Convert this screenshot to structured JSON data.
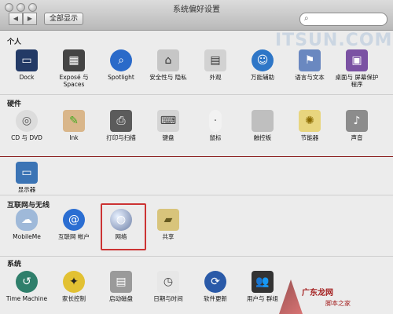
{
  "window": {
    "title": "系统偏好设置",
    "show_all": "全部显示",
    "search_placeholder": ""
  },
  "watermark": {
    "text": "ITSUN.COM"
  },
  "sections": [
    {
      "title": "个人",
      "items": [
        {
          "label": "Dock",
          "icon": "dock-icon",
          "color": "#233a66"
        },
        {
          "label": "Exposé 与 Spaces",
          "icon": "expose-spaces-icon",
          "color": "#444"
        },
        {
          "label": "Spotlight",
          "icon": "spotlight-icon",
          "color": "#2a6ac9"
        },
        {
          "label": "安全性与 隐私",
          "icon": "security-house-icon",
          "color": "#c6c6c6"
        },
        {
          "label": "外观",
          "icon": "appearance-icon",
          "color": "#d2d2d2"
        },
        {
          "label": "万能辅助",
          "icon": "accessibility-icon",
          "color": "#2e76c7"
        },
        {
          "label": "语言与文本",
          "icon": "language-flag-icon",
          "color": "#6a88c0"
        },
        {
          "label": "桌面与 屏幕保护程序",
          "icon": "desktop-screensaver-icon",
          "color": "#7b52a3"
        }
      ]
    },
    {
      "title": "硬件",
      "items": [
        {
          "label": "CD 与 DVD",
          "icon": "cd-dvd-icon",
          "color": "#dcdcdc"
        },
        {
          "label": "Ink",
          "icon": "ink-icon",
          "color": "#d9b68a"
        },
        {
          "label": "打印与扫描",
          "icon": "printer-icon",
          "color": "#5b5b5b"
        },
        {
          "label": "键盘",
          "icon": "keyboard-icon",
          "color": "#d5d5d5"
        },
        {
          "label": "鼠标",
          "icon": "mouse-icon",
          "color": "#f2f2f2"
        },
        {
          "label": "触控板",
          "icon": "trackpad-icon",
          "color": "#bfbfbf"
        },
        {
          "label": "节能器",
          "icon": "energy-bulb-icon",
          "color": "#e8d57e"
        },
        {
          "label": "声音",
          "icon": "speaker-icon",
          "color": "#8c8c8c"
        }
      ]
    },
    {
      "title": "",
      "items": [
        {
          "label": "显示器",
          "icon": "display-icon",
          "color": "#3b74b5"
        }
      ]
    },
    {
      "title": "互联网与无线",
      "items": [
        {
          "label": "MobileMe",
          "icon": "mobileme-cloud-icon",
          "color": "#9fb9d9"
        },
        {
          "label": "互联网 帐户",
          "icon": "internet-accounts-icon",
          "color": "#2b6ed2"
        },
        {
          "label": "网络",
          "icon": "network-globe-icon",
          "color": "#6c7ea5"
        },
        {
          "label": "共享",
          "icon": "sharing-folder-icon",
          "color": "#d8c47b"
        }
      ]
    },
    {
      "title": "系统",
      "items": [
        {
          "label": "Time Machine",
          "icon": "time-machine-icon",
          "color": "#2f7f6b"
        },
        {
          "label": "家长控制",
          "icon": "parental-controls-icon",
          "color": "#e2c133"
        },
        {
          "label": "启动磁盘",
          "icon": "startup-disk-icon",
          "color": "#9a9a9a"
        },
        {
          "label": "日期与时间",
          "icon": "date-time-icon",
          "color": "#e7e7e7"
        },
        {
          "label": "软件更新",
          "icon": "software-update-icon",
          "color": "#2a5aa8"
        },
        {
          "label": "用户与 群组",
          "icon": "users-groups-icon",
          "color": "#333"
        },
        {
          "label": "",
          "icon": "",
          "color": ""
        }
      ]
    }
  ],
  "overlay": {
    "brand": "广东龙网",
    "sub": "脚本之家"
  }
}
